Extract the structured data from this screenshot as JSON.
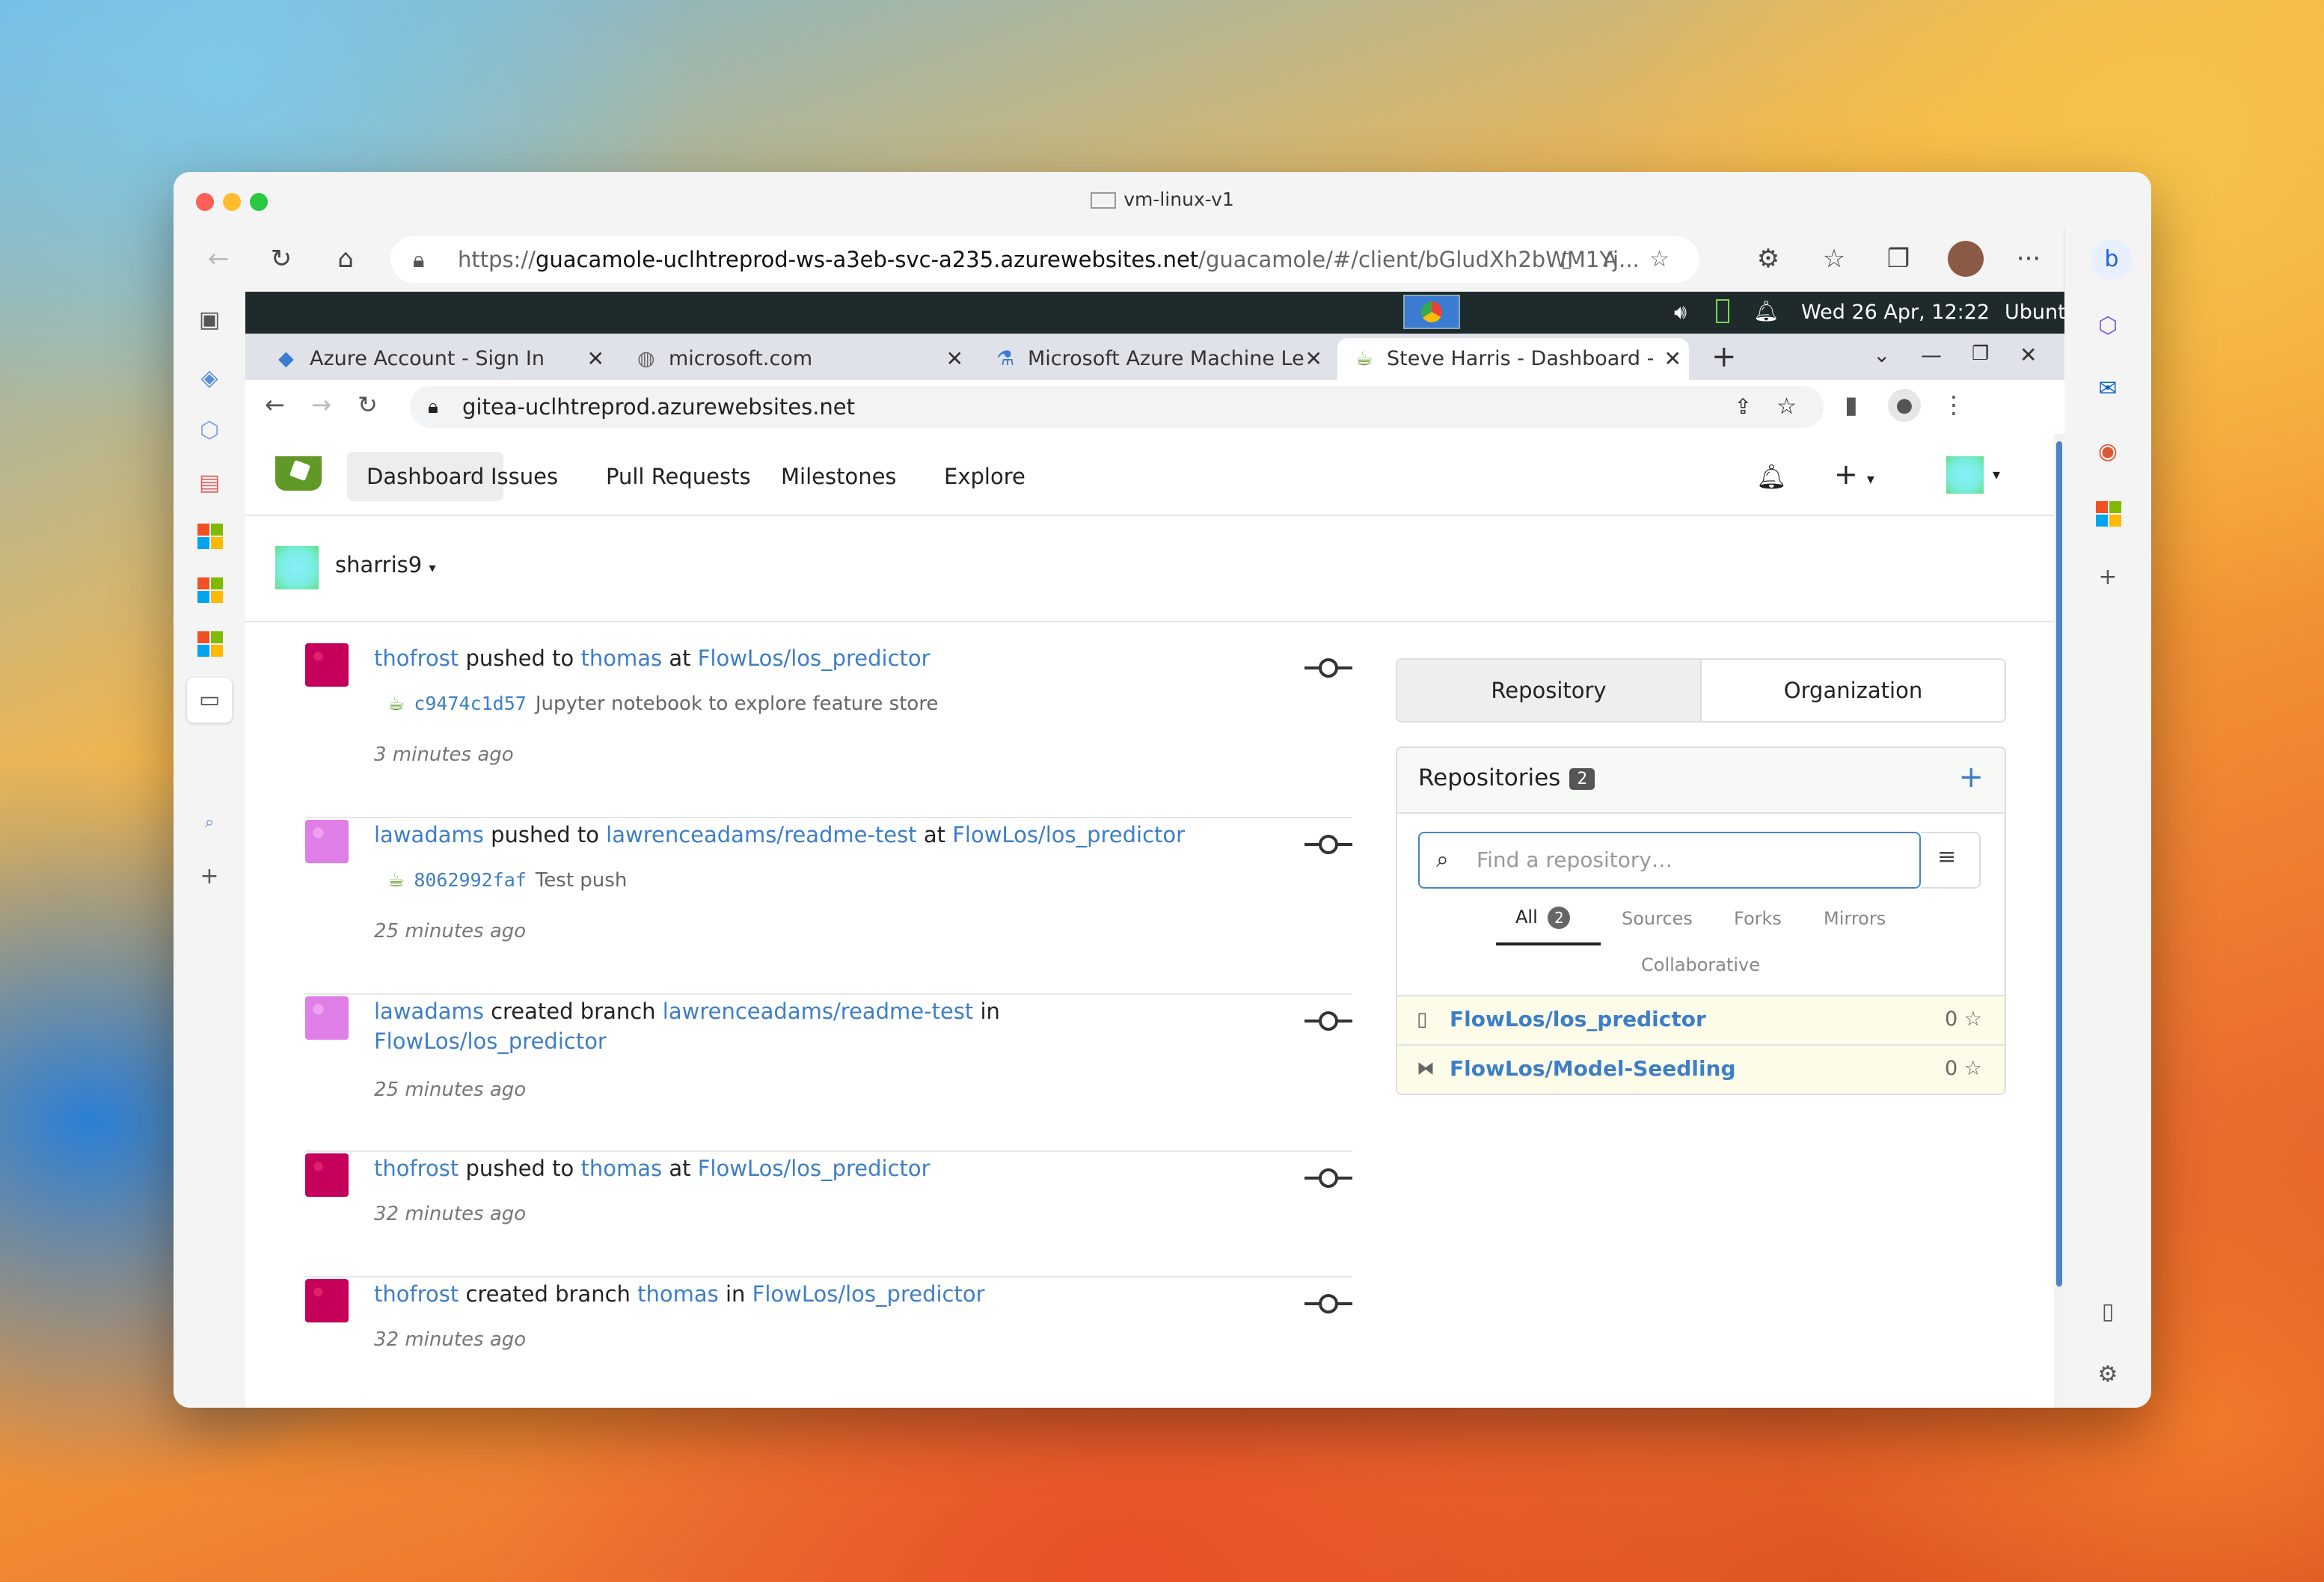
{
  "window": {
    "title": "vm-linux-v1"
  },
  "edge": {
    "url_prefix": "https://",
    "url_host": "guacamole-uclhtreprod-ws-a3eb-svc-a235.azurewebsites.net",
    "url_path": "/guacamole/#/client/bGludXh2bWM1Yj..."
  },
  "ubuntu": {
    "datetime": "Wed 26 Apr, 12:22",
    "os_label": "Ubuntu"
  },
  "chrome": {
    "tabs": [
      {
        "label": "Azure Account - Sign In"
      },
      {
        "label": "microsoft.com"
      },
      {
        "label": "Microsoft Azure Machine Le"
      },
      {
        "label": "Steve Harris - Dashboard -"
      }
    ],
    "url": "gitea-uclhtreprod.azurewebsites.net"
  },
  "gitea": {
    "nav": {
      "dashboard": "Dashboard",
      "issues": "Issues",
      "pulls": "Pull Requests",
      "milestones": "Milestones",
      "explore": "Explore"
    },
    "context_user": "sharris9",
    "feed": [
      {
        "user": "thofrost",
        "action": "pushed to",
        "target": "thomas",
        "prep": "at",
        "repo": "FlowLos/los_predictor",
        "commit_sha": "c9474c1d57",
        "commit_msg": "Jupyter notebook to explore feature store",
        "time": "3 minutes ago"
      },
      {
        "user": "lawadams",
        "action": "pushed to",
        "target": "lawrenceadams/readme-test",
        "prep": "at",
        "repo": "FlowLos/los_predictor",
        "commit_sha": "8062992faf",
        "commit_msg": "Test push",
        "time": "25 minutes ago"
      },
      {
        "user": "lawadams",
        "action": "created branch",
        "target": "lawrenceadams/readme-test",
        "prep": "in",
        "repo": "FlowLos/los_predictor",
        "time": "25 minutes ago"
      },
      {
        "user": "thofrost",
        "action": "pushed to",
        "target": "thomas",
        "prep": "at",
        "repo": "FlowLos/los_predictor",
        "time": "32 minutes ago"
      },
      {
        "user": "thofrost",
        "action": "created branch",
        "target": "thomas",
        "prep": "in",
        "repo": "FlowLos/los_predictor",
        "time": "32 minutes ago"
      }
    ],
    "panel": {
      "seg_repository": "Repository",
      "seg_organization": "Organization",
      "repos_title": "Repositories",
      "repos_count": "2",
      "search_placeholder": "Find a repository…",
      "tabs": {
        "all": "All",
        "all_count": "2",
        "sources": "Sources",
        "forks": "Forks",
        "mirrors": "Mirrors",
        "collaborative": "Collaborative"
      },
      "repos": [
        {
          "name": "FlowLos/los_predictor",
          "stars": "0"
        },
        {
          "name": "FlowLos/Model-Seedling",
          "stars": "0"
        }
      ]
    }
  },
  "colors": {
    "link": "#3d7ec7",
    "gitea_green": "#609926",
    "ubuntu_bar": "#1f2a2c"
  }
}
